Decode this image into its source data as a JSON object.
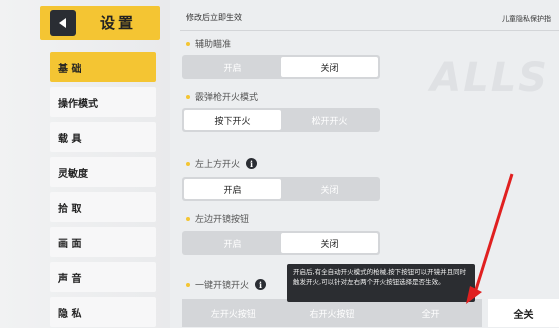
{
  "header": {
    "title": "设置",
    "back_icon": "back-arrow-icon",
    "accent": "#f4c533"
  },
  "sidebar": {
    "items": [
      {
        "label": "基 础",
        "active": true
      },
      {
        "label": "操作模式",
        "active": false
      },
      {
        "label": "载 具",
        "active": false
      },
      {
        "label": "灵敏度",
        "active": false
      },
      {
        "label": "拾 取",
        "active": false
      },
      {
        "label": "画 面",
        "active": false
      },
      {
        "label": "声 音",
        "active": false
      },
      {
        "label": "隐 私",
        "active": false
      }
    ]
  },
  "main": {
    "top_note": "修改后立即生效",
    "top_right_link": "儿童隐私保护指",
    "watermark": "ALLS",
    "settings": [
      {
        "label": "辅助瞄准",
        "options": [
          "开启",
          "关闭"
        ],
        "selected": 1
      },
      {
        "label": "霰弹枪开火模式",
        "options": [
          "按下开火",
          "松开开火"
        ],
        "selected": 0
      },
      {
        "label": "左上方开火",
        "options": [
          "开启",
          "关闭"
        ],
        "selected": 0,
        "info": "i"
      },
      {
        "label": "左边开镜按钮",
        "options": [
          "开启",
          "关闭"
        ],
        "selected": 1
      },
      {
        "label": "一键开镜开火",
        "options": [
          "左开火按钮",
          "右开火按钮",
          "全开"
        ],
        "selected": -1,
        "info": "i"
      }
    ],
    "full_button": "全关",
    "tooltip": "开启后,有全自动开火模式的枪械,按下按钮可以开镜并且同时触发开火,可以针对左右两个开火按钮选择是否生效。"
  }
}
